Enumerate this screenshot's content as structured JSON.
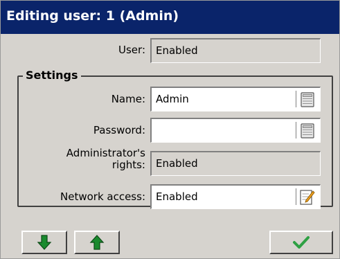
{
  "window": {
    "title": "Editing user: 1 (Admin)"
  },
  "user_row": {
    "label": "User:",
    "value": "Enabled"
  },
  "settings": {
    "legend": "Settings",
    "name": {
      "label": "Name:",
      "value": "Admin",
      "button_icon": "keypad-icon"
    },
    "password": {
      "label": "Password:",
      "value": "",
      "button_icon": "keypad-icon"
    },
    "admin_rights": {
      "label_line1": "Administrator's",
      "label_line2": "rights:",
      "value": "Enabled"
    },
    "network_access": {
      "label": "Network access:",
      "value": "Enabled",
      "button_icon": "edit-note-icon"
    }
  },
  "buttons": {
    "move_down_icon": "arrow-down-icon",
    "move_up_icon": "arrow-up-icon",
    "confirm_icon": "checkmark-icon"
  },
  "colors": {
    "titlebar": "#0a246a",
    "arrow": "#1a8a2e",
    "checkmark": "#2ea043"
  }
}
